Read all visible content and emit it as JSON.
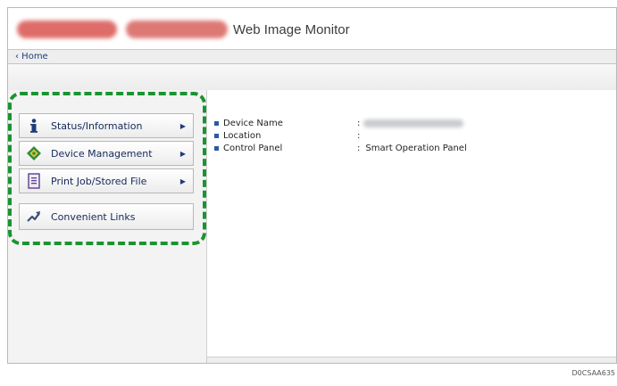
{
  "header": {
    "app_title": "Web Image Monitor"
  },
  "breadcrumb": {
    "home_label": "‹ Home"
  },
  "sidebar": {
    "items": [
      {
        "label": "Status/Information",
        "icon": "info-icon",
        "has_submenu": true
      },
      {
        "label": "Device Management",
        "icon": "device-management-icon",
        "has_submenu": true
      },
      {
        "label": "Print Job/Stored File",
        "icon": "document-icon",
        "has_submenu": true
      },
      {
        "label": "Convenient Links",
        "icon": "link-arrow-icon",
        "has_submenu": false
      }
    ],
    "submenu_glyph": "▶",
    "highlight_color": "#1a9431"
  },
  "device_info": {
    "rows": [
      {
        "label": "Device Name",
        "separator": ":",
        "value": ""
      },
      {
        "label": "Location",
        "separator": ":",
        "value": ""
      },
      {
        "label": "Control Panel",
        "separator": ":",
        "value": "Smart Operation Panel"
      }
    ],
    "bullet_color": "#2c58a8"
  },
  "footer": {
    "code": "D0CSAA635"
  }
}
